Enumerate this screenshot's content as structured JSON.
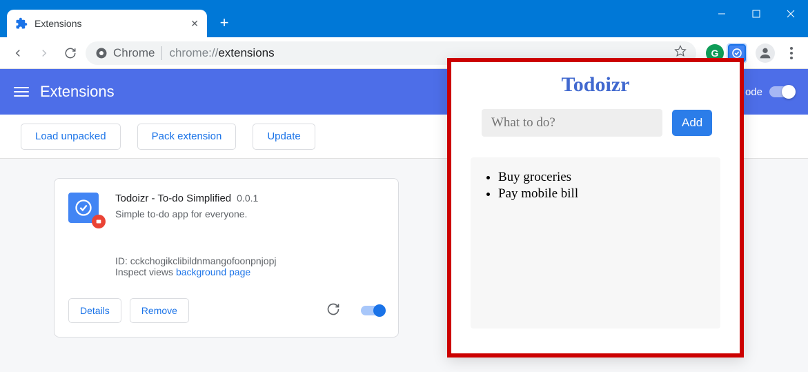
{
  "window": {
    "tab_title": "Extensions"
  },
  "omnibox": {
    "prefix": "Chrome",
    "url_gray": "chrome://",
    "url_bold": "extensions"
  },
  "extbar": {
    "title": "Extensions",
    "devmode_label": "ode"
  },
  "actions": {
    "load": "Load unpacked",
    "pack": "Pack extension",
    "update": "Update"
  },
  "card": {
    "name": "Todoizr - To-do Simplified",
    "version": "0.0.1",
    "desc": "Simple to-do app for everyone.",
    "id_label": "ID:",
    "id_value": "cckchogikclibildnmangofoonpnjopj",
    "inspect_label": "Inspect views",
    "inspect_link": "background page",
    "details": "Details",
    "remove": "Remove"
  },
  "popup": {
    "title": "Todoizr",
    "placeholder": "What to do?",
    "add": "Add",
    "items": [
      "Buy groceries",
      "Pay mobile bill"
    ]
  }
}
